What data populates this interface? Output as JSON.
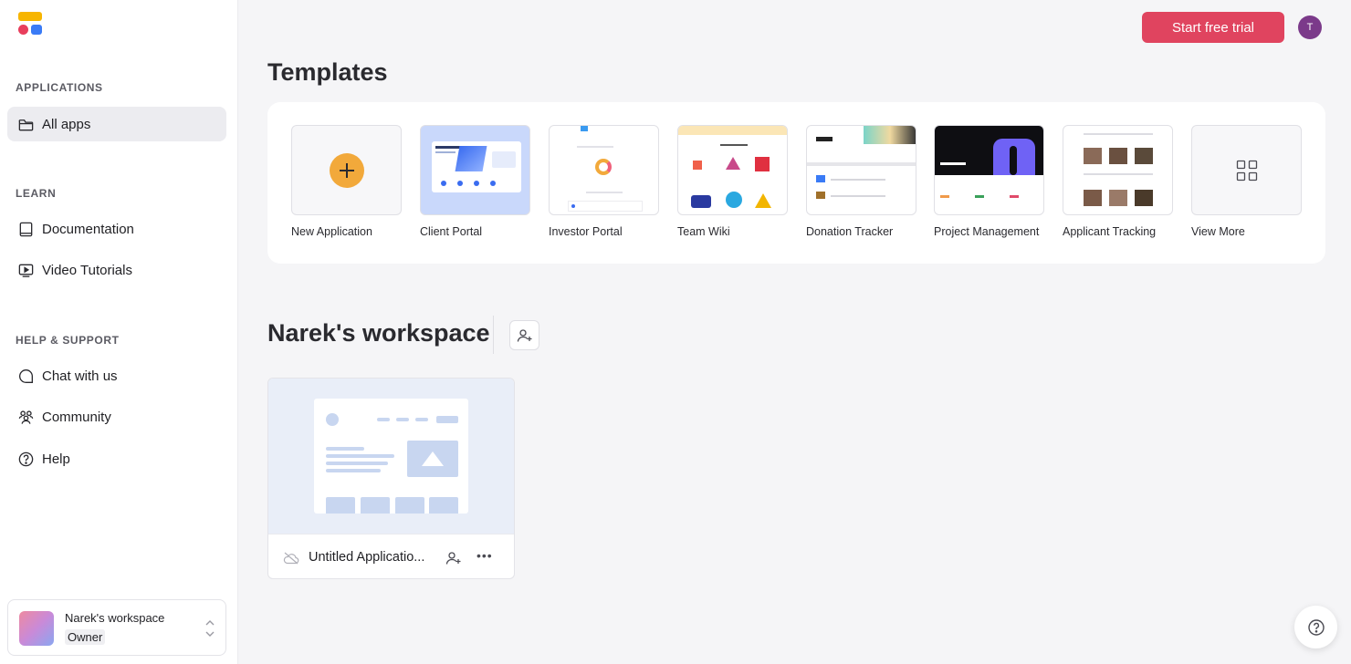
{
  "sidebar": {
    "sections": [
      {
        "title": "APPLICATIONS",
        "items": [
          {
            "label": "All apps",
            "icon": "folder-icon",
            "active": true
          }
        ]
      },
      {
        "title": "LEARN",
        "items": [
          {
            "label": "Documentation",
            "icon": "book-icon"
          },
          {
            "label": "Video Tutorials",
            "icon": "video-icon"
          }
        ]
      },
      {
        "title": "HELP & SUPPORT",
        "items": [
          {
            "label": "Chat with us",
            "icon": "chat-bubble-icon"
          },
          {
            "label": "Community",
            "icon": "people-icon"
          },
          {
            "label": "Help",
            "icon": "question-circle-icon"
          }
        ]
      }
    ],
    "workspace_switcher": {
      "name": "Narek's workspace",
      "role": "Owner"
    }
  },
  "header": {
    "trial_button": "Start free trial",
    "avatar_initial": "T",
    "trial_color": "#e0445f",
    "avatar_color": "#7b3a8a"
  },
  "templates": {
    "title": "Templates",
    "items": [
      {
        "label": "New Application"
      },
      {
        "label": "Client Portal"
      },
      {
        "label": "Investor Portal"
      },
      {
        "label": "Team Wiki"
      },
      {
        "label": "Donation Tracker"
      },
      {
        "label": "Project Management"
      },
      {
        "label": "Applicant Tracking"
      },
      {
        "label": "View More"
      }
    ]
  },
  "workspace": {
    "title": "Narek's workspace",
    "apps": [
      {
        "name": "Untitled Applicatio..."
      }
    ]
  }
}
